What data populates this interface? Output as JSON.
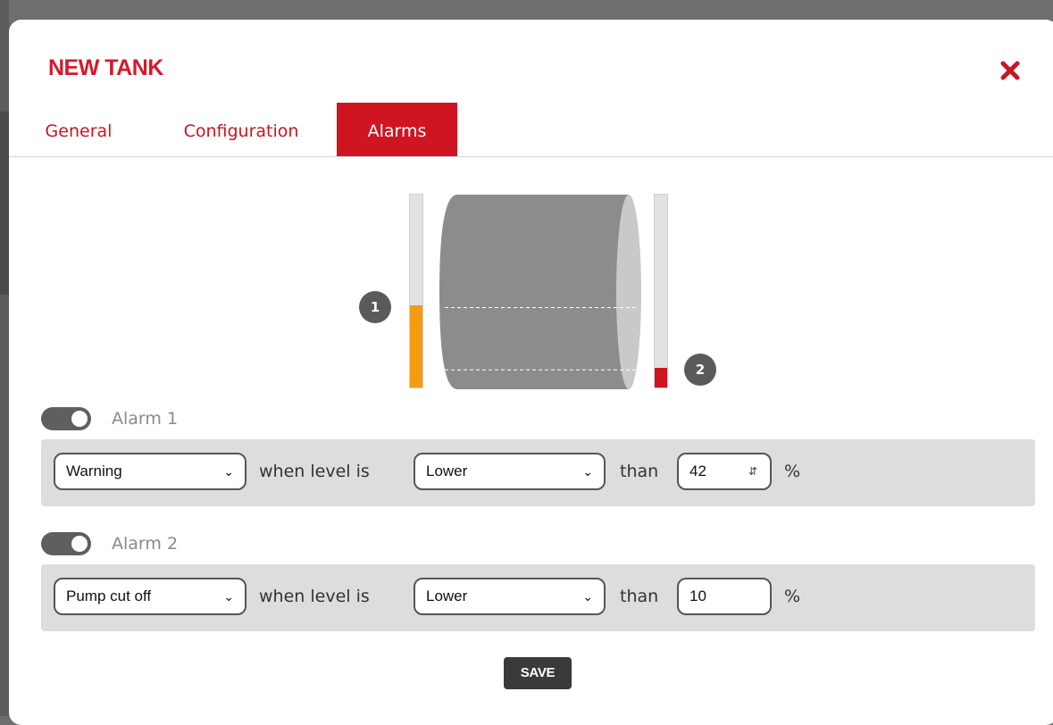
{
  "modal": {
    "title": "NEW TANK",
    "close_icon": "close-icon"
  },
  "tabs": [
    {
      "label": "General",
      "active": false
    },
    {
      "label": "Configuration",
      "active": false
    },
    {
      "label": "Alarms",
      "active": true
    }
  ],
  "tank": {
    "marker_1": "1",
    "marker_2": "2",
    "alarm1_level_percent": 42,
    "alarm2_level_percent": 10,
    "alarm1_color": "#f39c12",
    "alarm2_color": "#d01522",
    "tank_color": "#8c8c8c"
  },
  "alarms": [
    {
      "label": "Alarm 1",
      "enabled": true,
      "type": "Warning",
      "connector": "when level is",
      "comparison": "Lower",
      "than": "than",
      "value": "42",
      "unit": "%"
    },
    {
      "label": "Alarm 2",
      "enabled": true,
      "type": "Pump cut off",
      "connector": "when level is",
      "comparison": "Lower",
      "than": "than",
      "value": "10",
      "unit": "%"
    }
  ],
  "save_label": "SAVE",
  "colors": {
    "accent": "#d01522",
    "toggle_on": "#5f5f5f"
  }
}
